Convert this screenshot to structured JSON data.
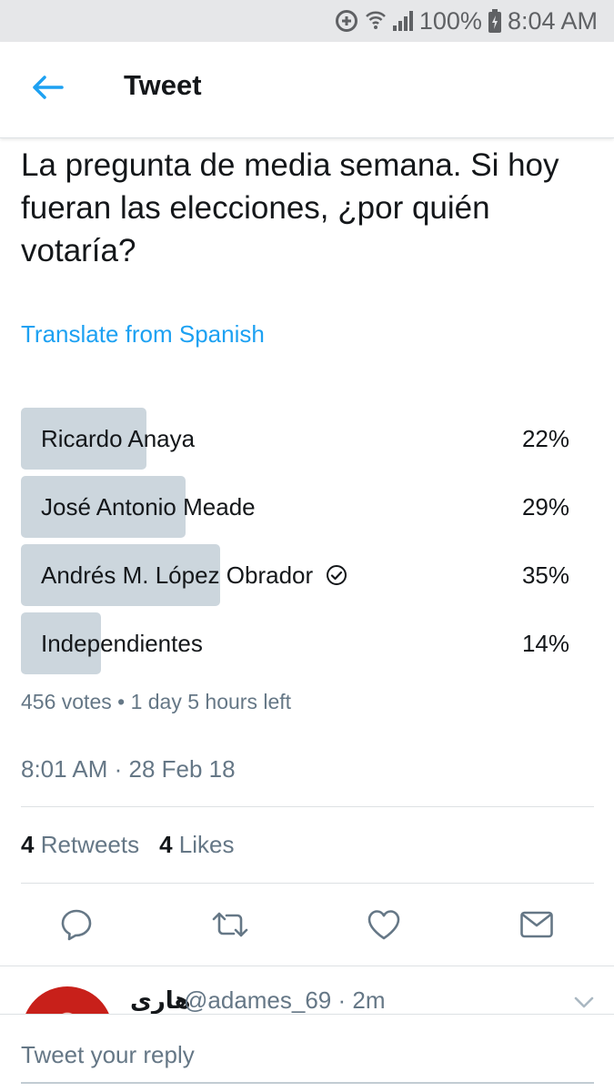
{
  "status_bar": {
    "battery": "100%",
    "time": "8:04 AM"
  },
  "header": {
    "title": "Tweet"
  },
  "tweet": {
    "text": "La pregunta de media semana. Si hoy fueran las elecciones, ¿por quién votaría?",
    "translate_label": "Translate from Spanish",
    "poll": {
      "options": [
        {
          "label": "Ricardo Anaya",
          "percent_label": "22%",
          "share": 0.22,
          "selected": false
        },
        {
          "label": "José Antonio Meade",
          "percent_label": "29%",
          "share": 0.29,
          "selected": false
        },
        {
          "label": "Andrés M. López Obrador",
          "percent_label": "35%",
          "share": 0.35,
          "selected": true
        },
        {
          "label": "Independientes",
          "percent_label": "14%",
          "share": 0.14,
          "selected": false
        }
      ],
      "meta": "456 votes • 1 day 5 hours left"
    },
    "timestamp": "8:01 AM · 28 Feb 18",
    "stats": {
      "retweets_count": "4",
      "retweets_label": "Retweets",
      "likes_count": "4",
      "likes_label": "Likes"
    },
    "actions": [
      "reply-icon",
      "retweet-icon",
      "like-icon",
      "direct-message-icon"
    ]
  },
  "reply_preview": {
    "name": "هاری",
    "handle_time": "@adames_69 · 2m"
  },
  "reply_box": {
    "placeholder": "Tweet your reply"
  },
  "colors": {
    "accent": "#1da1f2",
    "poll_bar": "#ccd6dd",
    "secondary_text": "#657786",
    "status_bar_bg": "#e6e7e9"
  }
}
